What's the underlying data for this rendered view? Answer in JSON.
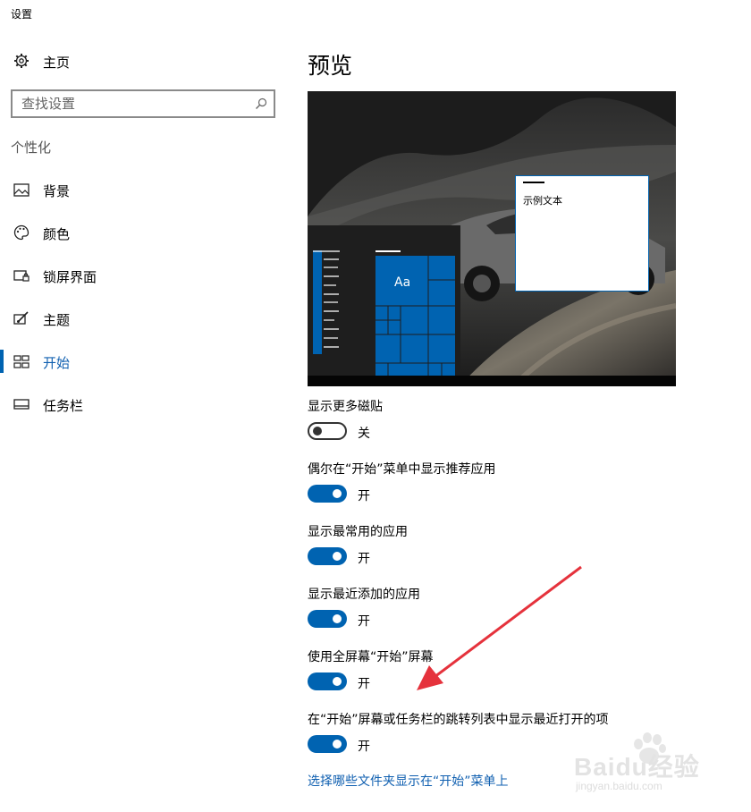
{
  "window": {
    "title": "设置"
  },
  "sidebar": {
    "home_label": "主页",
    "search_placeholder": "查找设置",
    "section_title": "个性化",
    "items": [
      {
        "label": "背景",
        "icon": "picture-icon"
      },
      {
        "label": "颜色",
        "icon": "palette-icon"
      },
      {
        "label": "锁屏界面",
        "icon": "lock-screen-icon"
      },
      {
        "label": "主题",
        "icon": "theme-brush-icon"
      },
      {
        "label": "开始",
        "icon": "start-tiles-icon",
        "active": true
      },
      {
        "label": "任务栏",
        "icon": "taskbar-icon"
      }
    ]
  },
  "main": {
    "title": "预览",
    "preview": {
      "tile_text": "Aa",
      "sample_text": "示例文本"
    },
    "settings": [
      {
        "label": "显示更多磁贴",
        "on": false,
        "state_text": "关"
      },
      {
        "label": "偶尔在“开始”菜单中显示推荐应用",
        "on": true,
        "state_text": "开"
      },
      {
        "label": "显示最常用的应用",
        "on": true,
        "state_text": "开"
      },
      {
        "label": "显示最近添加的应用",
        "on": true,
        "state_text": "开"
      },
      {
        "label": "使用全屏幕“开始”屏幕",
        "on": true,
        "state_text": "开"
      },
      {
        "label": "在“开始”屏幕或任务栏的跳转列表中显示最近打开的项",
        "on": true,
        "state_text": "开"
      }
    ],
    "link_text": "选择哪些文件夹显示在“开始”菜单上"
  },
  "watermark": {
    "line1": "Baidu经验",
    "line2": "jingyan.baidu.com"
  },
  "colors": {
    "accent": "#0063b1",
    "link": "#0f5fb0",
    "annotation_arrow": "#e5323c"
  }
}
